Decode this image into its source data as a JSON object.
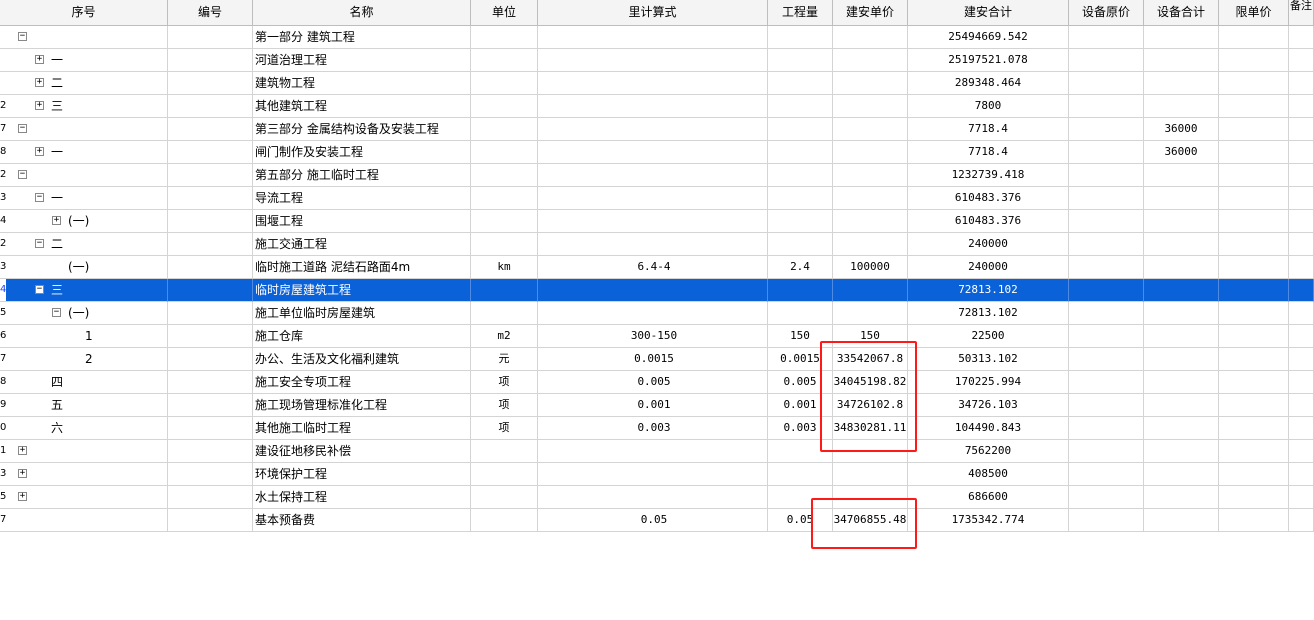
{
  "columns": [
    "序号",
    "编号",
    "名称",
    "单位",
    "里计算式",
    "工程量",
    "建安单价",
    "建安合计",
    "设备原价",
    "设备合计",
    "限单价",
    "备注"
  ],
  "rows": [
    {
      "rownum": "",
      "tree": "",
      "seq": "",
      "name": "第一部分  建筑工程",
      "unit": "",
      "formula": "",
      "qty": "",
      "price": "",
      "total": "25494669.542",
      "equip_total": ""
    },
    {
      "rownum": "",
      "tree": "",
      "seq": "一",
      "name": "河道治理工程",
      "unit": "",
      "formula": "",
      "qty": "",
      "price": "",
      "total": "25197521.078",
      "equip_total": ""
    },
    {
      "rownum": "",
      "tree": "",
      "seq": "二",
      "name": "建筑物工程",
      "unit": "",
      "formula": "",
      "qty": "",
      "price": "",
      "total": "289348.464",
      "equip_total": ""
    },
    {
      "rownum": "2",
      "tree": "",
      "seq": "三",
      "name": "其他建筑工程",
      "unit": "",
      "formula": "",
      "qty": "",
      "price": "",
      "total": "7800",
      "equip_total": ""
    },
    {
      "rownum": "7",
      "tree": "",
      "seq": "",
      "name": "第三部分  金属结构设备及安装工程",
      "unit": "",
      "formula": "",
      "qty": "",
      "price": "",
      "total": "7718.4",
      "equip_total": "36000"
    },
    {
      "rownum": "8",
      "tree": "",
      "seq": "一",
      "name": "闸门制作及安装工程",
      "unit": "",
      "formula": "",
      "qty": "",
      "price": "",
      "total": "7718.4",
      "equip_total": "36000"
    },
    {
      "rownum": "2",
      "tree": "",
      "seq": "",
      "name": "第五部分  施工临时工程",
      "unit": "",
      "formula": "",
      "qty": "",
      "price": "",
      "total": "1232739.418",
      "equip_total": ""
    },
    {
      "rownum": "3",
      "tree": "",
      "seq": "一",
      "name": "导流工程",
      "unit": "",
      "formula": "",
      "qty": "",
      "price": "",
      "total": "610483.376",
      "equip_total": ""
    },
    {
      "rownum": "4",
      "tree": "",
      "seq": "(一)",
      "name": "围堰工程",
      "unit": "",
      "formula": "",
      "qty": "",
      "price": "",
      "total": "610483.376",
      "equip_total": ""
    },
    {
      "rownum": "2",
      "tree": "",
      "seq": "二",
      "name": "施工交通工程",
      "unit": "",
      "formula": "",
      "qty": "",
      "price": "",
      "total": "240000",
      "equip_total": ""
    },
    {
      "rownum": "3",
      "tree": "",
      "seq": "(一)",
      "name": "临时施工道路  泥结石路面4m",
      "unit": "km",
      "formula": "6.4-4",
      "qty": "2.4",
      "price": "100000",
      "total": "240000",
      "equip_total": ""
    },
    {
      "rownum": "4",
      "tree": "",
      "seq": "三",
      "name": "临时房屋建筑工程",
      "unit": "",
      "formula": "",
      "qty": "",
      "price": "",
      "total": "72813.102",
      "equip_total": ""
    },
    {
      "rownum": "5",
      "tree": "",
      "seq": "(一)",
      "name": "施工单位临时房屋建筑",
      "unit": "",
      "formula": "",
      "qty": "",
      "price": "",
      "total": "72813.102",
      "equip_total": ""
    },
    {
      "rownum": "6",
      "tree": "",
      "seq": "1",
      "name": "施工仓库",
      "unit": "m2",
      "formula": "300-150",
      "qty": "150",
      "price": "150",
      "total": "22500",
      "equip_total": ""
    },
    {
      "rownum": "7",
      "tree": "",
      "seq": "2",
      "name": "办公、生活及文化福利建筑",
      "unit": "元",
      "formula": "0.0015",
      "qty": "0.0015",
      "price": "33542067.8",
      "total": "50313.102",
      "equip_total": ""
    },
    {
      "rownum": "8",
      "tree": "",
      "seq": "四",
      "name": "施工安全专项工程",
      "unit": "项",
      "formula": "0.005",
      "qty": "0.005",
      "price": "34045198.82",
      "total": "170225.994",
      "equip_total": ""
    },
    {
      "rownum": "9",
      "tree": "",
      "seq": "五",
      "name": "施工现场管理标准化工程",
      "unit": "项",
      "formula": "0.001",
      "qty": "0.001",
      "price": "34726102.8",
      "total": "34726.103",
      "equip_total": ""
    },
    {
      "rownum": "0",
      "tree": "",
      "seq": "六",
      "name": "其他施工临时工程",
      "unit": "项",
      "formula": "0.003",
      "qty": "0.003",
      "price": "34830281.11",
      "total": "104490.843",
      "equip_total": ""
    },
    {
      "rownum": "1",
      "tree": "",
      "seq": "",
      "name": "建设征地移民补偿",
      "unit": "",
      "formula": "",
      "qty": "",
      "price": "",
      "total": "7562200",
      "equip_total": ""
    },
    {
      "rownum": "3",
      "tree": "",
      "seq": "",
      "name": "环境保护工程",
      "unit": "",
      "formula": "",
      "qty": "",
      "price": "",
      "total": "408500",
      "equip_total": ""
    },
    {
      "rownum": "5",
      "tree": "",
      "seq": "",
      "name": "水土保持工程",
      "unit": "",
      "formula": "",
      "qty": "",
      "price": "",
      "total": "686600",
      "equip_total": ""
    },
    {
      "rownum": "7",
      "tree": "",
      "seq": "",
      "name": "基本预备费",
      "unit": "",
      "formula": "0.05",
      "qty": "0.05",
      "price": "34706855.48",
      "total": "1735342.774",
      "equip_total": ""
    }
  ],
  "selected_row": 11,
  "colors": {
    "selection": "#0b62d8",
    "highlight_box": "#ff1a1a",
    "grid_line": "#d4d4d4",
    "header_bg": "#f4f4f4"
  }
}
